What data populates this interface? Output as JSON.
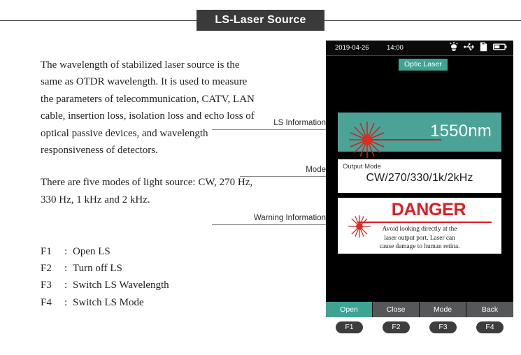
{
  "page": {
    "title": "LS-Laser Source"
  },
  "article": {
    "paragraph1": "The wavelength of stabilized laser source is the same as OTDR wavelength. It is used to measure the parameters of telecommunication, CATV, LAN cable, insertion loss, isolation loss and echo loss of optical passive devices, and wavelength responsiveness of detectors.",
    "paragraph2": "There are five modes of light source: CW, 270 Hz, 330 Hz, 1 kHz and 2 kHz.",
    "function_keys": [
      {
        "key": "F1",
        "sep": ":",
        "label": "Open LS"
      },
      {
        "key": "F2",
        "sep": ":",
        "label": "Turn off LS"
      },
      {
        "key": "F3",
        "sep": ":",
        "label": "Switch LS Wavelength"
      },
      {
        "key": "F4",
        "sep": ":",
        "label": "Switch LS Mode"
      }
    ]
  },
  "callouts": {
    "ls_information": "LS Information",
    "mode": "Mode",
    "warning_information": "Warning Information"
  },
  "device": {
    "status_bar": {
      "date": "2019-04-26",
      "time": "14:00",
      "icons": [
        "lamp-icon",
        "usb-icon",
        "sdcard-icon",
        "battery-icon"
      ]
    },
    "tab": {
      "label": "Optic Laser"
    },
    "ls_information": {
      "wavelength": "1550nm",
      "icon": "laser-burst-icon"
    },
    "output_mode": {
      "label": "Output Mode",
      "value": "CW/270/330/1k/2kHz"
    },
    "warning": {
      "title": "DANGER",
      "icon": "laser-burst-icon",
      "line1": "Avoid looking directly at the",
      "line2": "laser output port. Laser can",
      "line3": "cause damage to human retina."
    },
    "softkeys": [
      {
        "label": "Open",
        "fkey": "F1",
        "active": true
      },
      {
        "label": "Close",
        "fkey": "F2",
        "active": false
      },
      {
        "label": "Mode",
        "fkey": "F3",
        "active": false
      },
      {
        "label": "Back",
        "fkey": "F4",
        "active": false
      }
    ]
  },
  "colors": {
    "teal": "#4aa396",
    "danger_red": "#e01b22",
    "laser_red": "#cc2222",
    "banner_gray": "#3a3a3a",
    "softkey_gray": "#555759"
  }
}
